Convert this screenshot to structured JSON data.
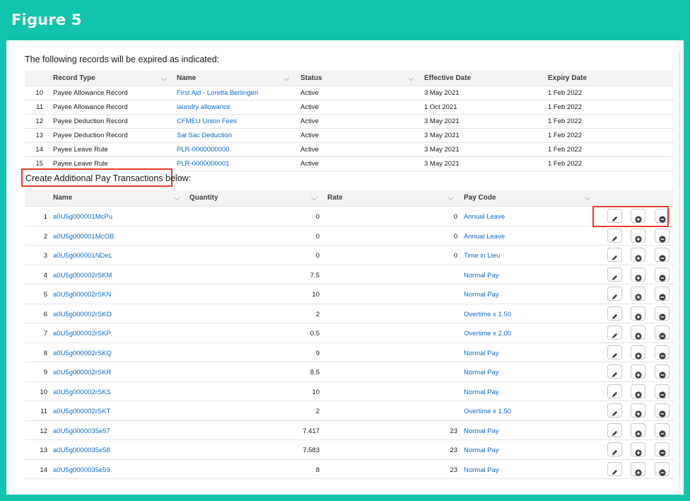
{
  "figure_title": "Figure 5",
  "intro_text": "The following records will be expired as indicated:",
  "expire_table": {
    "headers": [
      "Record Type",
      "Name",
      "Status",
      "Effective Date",
      "Expiry Date"
    ],
    "rows": [
      {
        "num": "10",
        "type": "Payee Allowance Record",
        "name": "First Aid - Loretta Berlingeri",
        "status": "Active",
        "effective": "3 May 2021",
        "expiry": "1 Feb 2022"
      },
      {
        "num": "11",
        "type": "Payee Allowance Record",
        "name": "laundry allowance",
        "status": "Active",
        "effective": "1 Oct 2021",
        "expiry": "1 Feb 2022"
      },
      {
        "num": "12",
        "type": "Payee Deduction Record",
        "name": "CFMEU Union Fees",
        "status": "Active",
        "effective": "3 May 2021",
        "expiry": "1 Feb 2022"
      },
      {
        "num": "13",
        "type": "Payee Deduction Record",
        "name": "Sal Sac Deduction",
        "status": "Active",
        "effective": "3 May 2021",
        "expiry": "1 Feb 2022"
      },
      {
        "num": "14",
        "type": "Payee Leave Rule",
        "name": "PLR-0000000000",
        "status": "Active",
        "effective": "3 May 2021",
        "expiry": "1 Feb 2022"
      },
      {
        "num": "15",
        "type": "Payee Leave Rule",
        "name": "PLR-0000000001",
        "status": "Active",
        "effective": "3 May 2021",
        "expiry": "1 Feb 2022"
      }
    ]
  },
  "create_heading": "Create Additional Pay Transactions below:",
  "pay_table": {
    "headers": [
      "Name",
      "Quantity",
      "Rate",
      "Pay Code"
    ],
    "rows": [
      {
        "num": "1",
        "name": "a0U5g000001McPu",
        "quantity": "0",
        "rate": "0",
        "pay_code": "Annual Leave"
      },
      {
        "num": "2",
        "name": "a0U5g000001McOB",
        "quantity": "0",
        "rate": "0",
        "pay_code": "Annual Leave"
      },
      {
        "num": "3",
        "name": "a0U5g000001NDeL",
        "quantity": "0",
        "rate": "0",
        "pay_code": "Time in Lieu"
      },
      {
        "num": "4",
        "name": "a0U5g000002rSKM",
        "quantity": "7.5",
        "rate": "",
        "pay_code": "Normal Pay"
      },
      {
        "num": "5",
        "name": "a0U5g000002rSKN",
        "quantity": "10",
        "rate": "",
        "pay_code": "Normal Pay"
      },
      {
        "num": "6",
        "name": "a0U5g000002rSKO",
        "quantity": "2",
        "rate": "",
        "pay_code": "Overtime x 1.50"
      },
      {
        "num": "7",
        "name": "a0U5g000002rSKP",
        "quantity": "0.5",
        "rate": "",
        "pay_code": "Overtime x 2.00"
      },
      {
        "num": "8",
        "name": "a0U5g000002rSKQ",
        "quantity": "9",
        "rate": "",
        "pay_code": "Normal Pay"
      },
      {
        "num": "9",
        "name": "a0U5g000002rSKR",
        "quantity": "8.5",
        "rate": "",
        "pay_code": "Normal Pay"
      },
      {
        "num": "10",
        "name": "a0U5g000002rSKS",
        "quantity": "10",
        "rate": "",
        "pay_code": "Normal Pay"
      },
      {
        "num": "11",
        "name": "a0U5g000002rSKT",
        "quantity": "2",
        "rate": "",
        "pay_code": "Overtime x 1.50"
      },
      {
        "num": "12",
        "name": "a0U5g0000035e57",
        "quantity": "7.417",
        "rate": "23",
        "pay_code": "Normal Pay"
      },
      {
        "num": "13",
        "name": "a0U5g0000035e58",
        "quantity": "7.583",
        "rate": "23",
        "pay_code": "Normal Pay"
      },
      {
        "num": "14",
        "name": "a0U5g0000035e59",
        "quantity": "8",
        "rate": "23",
        "pay_code": "Normal Pay"
      }
    ]
  },
  "row_actions": [
    "pencil-icon",
    "add-circle-icon",
    "remove-circle-icon"
  ],
  "colors": {
    "frame": "#12c4ad",
    "link": "#0b6bcb",
    "highlight": "#e53b2c"
  }
}
